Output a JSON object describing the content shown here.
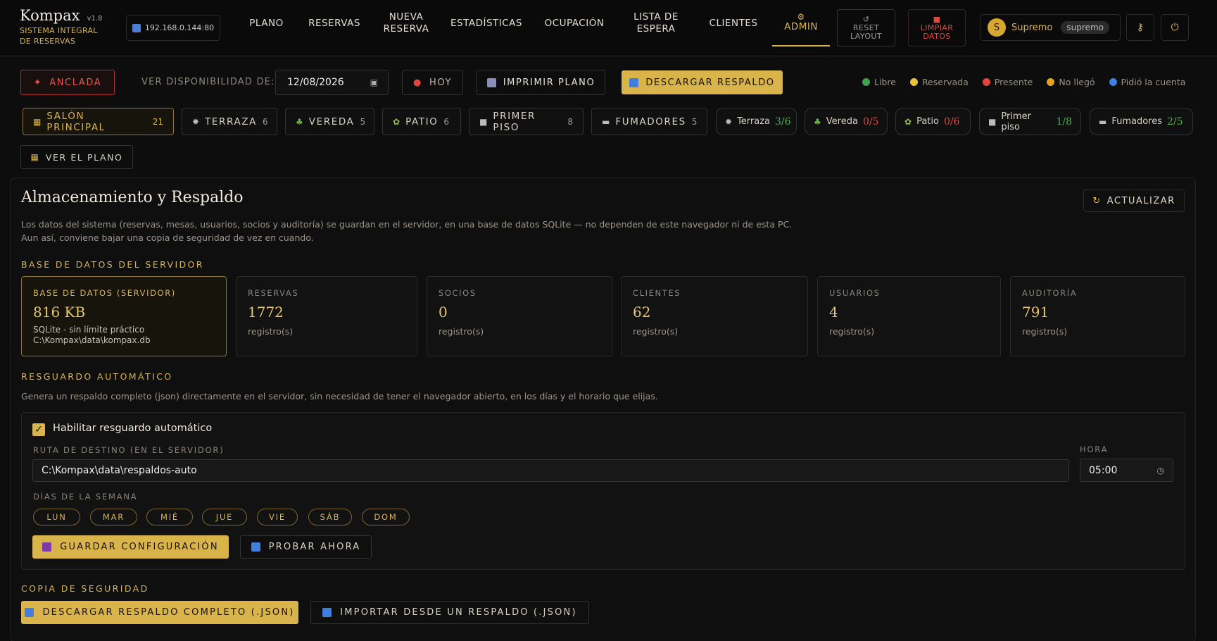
{
  "app": {
    "name": "Kompax",
    "version": "v1.8",
    "subtitle": "SISTEMA INTEGRAL DE RESERVAS",
    "server_ip": "192.168.0.144:80"
  },
  "nav": {
    "items": [
      {
        "label": "PLANO"
      },
      {
        "label": "RESERVAS"
      },
      {
        "label": "NUEVA RESERVA"
      },
      {
        "label": "ESTADÍSTICAS"
      },
      {
        "label": "OCUPACIÓN"
      },
      {
        "label": "LISTA DE ESPERA"
      },
      {
        "label": "CLIENTES"
      },
      {
        "label": "ADMIN",
        "active": true
      }
    ],
    "reset_layout": "RESET LAYOUT",
    "clear_data": "LIMPIAR DATOS"
  },
  "user": {
    "initial": "S",
    "name": "Supremo",
    "role": "supremo"
  },
  "toolbar": {
    "pinned_label": "ANCLADA",
    "availability_label": "VER DISPONIBILIDAD DE:",
    "date_value": "12/08/2026",
    "today_label": "HOY",
    "print_label": "IMPRIMIR PLANO",
    "download_label": "DESCARGAR RESPALDO"
  },
  "legend": [
    {
      "label": "Libre",
      "color": "#3fa34d"
    },
    {
      "label": "Reservada",
      "color": "#e8c23a"
    },
    {
      "label": "Presente",
      "color": "#e0473f"
    },
    {
      "label": "No llegó",
      "color": "#e8a21a"
    },
    {
      "label": "Pidió la cuenta",
      "color": "#3f7fe0"
    }
  ],
  "zones": [
    {
      "label": "SALÓN PRINCIPAL",
      "count": "21",
      "icon": "grid-icon",
      "selected": true
    },
    {
      "label": "TERRAZA",
      "count": "6",
      "icon": "sun-icon"
    },
    {
      "label": "VEREDA",
      "count": "5",
      "icon": "tree-icon"
    },
    {
      "label": "PATIO",
      "count": "6",
      "icon": "plant-icon"
    },
    {
      "label": "PRIMER PISO",
      "count": "8",
      "icon": "square-icon"
    },
    {
      "label": "FUMADORES",
      "count": "5",
      "icon": "cigarette-icon"
    }
  ],
  "occupancy": [
    {
      "label": "Terraza",
      "ratio": "3/6",
      "status": "green"
    },
    {
      "label": "Vereda",
      "ratio": "0/5",
      "status": "red"
    },
    {
      "label": "Patio",
      "ratio": "0/6",
      "status": "red"
    },
    {
      "label": "Primer piso",
      "ratio": "1/8",
      "status": "green"
    },
    {
      "label": "Fumadores",
      "ratio": "2/5",
      "status": "green"
    }
  ],
  "view_plan_label": "VER EL PLANO",
  "storage": {
    "title": "Almacenamiento y Respaldo",
    "refresh_label": "ACTUALIZAR",
    "desc_line1": "Los datos del sistema (reservas, mesas, usuarios, socios y auditoría) se guardan en el servidor, en una base de datos SQLite — no dependen de este navegador ni de esta PC.",
    "desc_line2": "Aun así, conviene bajar una copia de seguridad de vez en cuando.",
    "db_section": "BASE DE DATOS DEL SERVIDOR",
    "db_card": {
      "title": "BASE DE DATOS (SERVIDOR)",
      "size": "816 KB",
      "line1": "SQLite - sin límite práctico",
      "line2": "C:\\Kompax\\data\\kompax.db"
    },
    "tables": [
      {
        "title": "RESERVAS",
        "value": "1772",
        "unit": "registro(s)"
      },
      {
        "title": "SOCIOS",
        "value": "0",
        "unit": "registro(s)"
      },
      {
        "title": "CLIENTES",
        "value": "62",
        "unit": "registro(s)"
      },
      {
        "title": "USUARIOS",
        "value": "4",
        "unit": "registro(s)"
      },
      {
        "title": "AUDITORÍA",
        "value": "791",
        "unit": "registro(s)"
      }
    ],
    "auto_section": "RESGUARDO AUTOMÁTICO",
    "auto_desc": "Genera un respaldo completo (json) directamente en el servidor, sin necesidad de tener el navegador abierto, en los días y el horario que elijas.",
    "auto_enable_label": "Habilitar resguardo automático",
    "auto_enabled": true,
    "path_label": "RUTA DE DESTINO (EN EL SERVIDOR)",
    "path_value": "C:\\Kompax\\data\\respaldos-auto",
    "hour_label": "HORA",
    "hour_value": "05:00",
    "days_label": "DÍAS DE LA SEMANA",
    "days": [
      "LUN",
      "MAR",
      "MIÉ",
      "JUE",
      "VIE",
      "SÁB",
      "DOM"
    ],
    "save_config_label": "GUARDAR CONFIGURACIÓN",
    "test_now_label": "PROBAR AHORA",
    "copy_section": "COPIA DE SEGURIDAD",
    "download_full_label": "DESCARGAR RESPALDO COMPLETO (.JSON)",
    "import_label": "IMPORTAR DESDE UN RESPALDO (.JSON)"
  }
}
